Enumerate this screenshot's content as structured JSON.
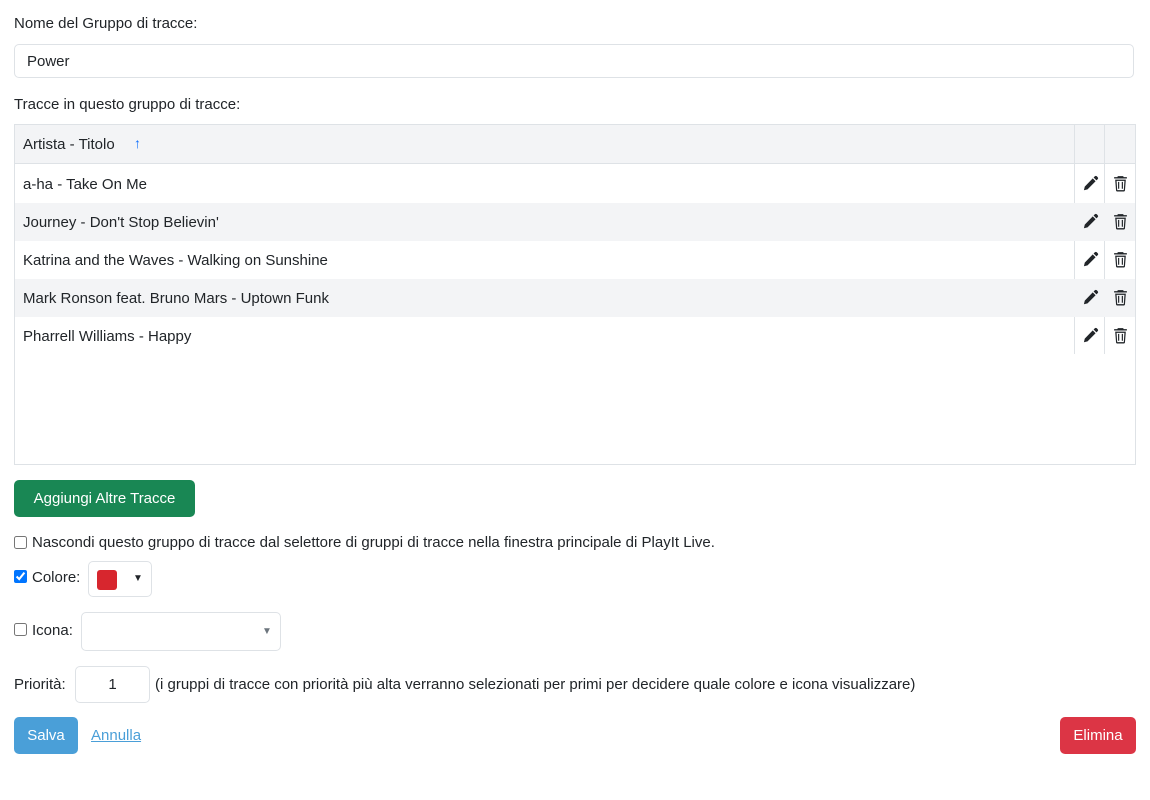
{
  "group_name_label": "Nome del Gruppo di tracce:",
  "group_name_value": "Power",
  "tracks_label": "Tracce in questo gruppo di tracce:",
  "table": {
    "column_header": "Artista - Titolo",
    "sort_indicator": "↑",
    "rows": [
      "a-ha - Take On Me",
      "Journey - Don't Stop Believin'",
      "Katrina and the Waves - Walking on Sunshine",
      "Mark Ronson feat. Bruno Mars - Uptown Funk",
      "Pharrell Williams - Happy"
    ]
  },
  "add_tracks_button": "Aggiungi Altre Tracce",
  "hide_option": {
    "checked": false,
    "label": "Nascondi questo gruppo di tracce dal selettore di gruppi di tracce nella finestra principale di PlayIt Live."
  },
  "color_option": {
    "checked": true,
    "label": "Colore:",
    "value": "#d7262e"
  },
  "icon_option": {
    "checked": false,
    "label": "Icona:",
    "value": ""
  },
  "priority": {
    "label": "Priorità:",
    "value": "1",
    "hint": "(i gruppi di tracce con priorità più alta verranno selezionati per primi per decidere quale colore e icona visualizzare)"
  },
  "save_button": "Salva",
  "cancel_link": "Annulla",
  "delete_button": "Elimina",
  "colors": {
    "green": "#198754",
    "blue": "#4a9fd8",
    "red": "#dc3545",
    "sort_arrow": "#0d6efd"
  }
}
